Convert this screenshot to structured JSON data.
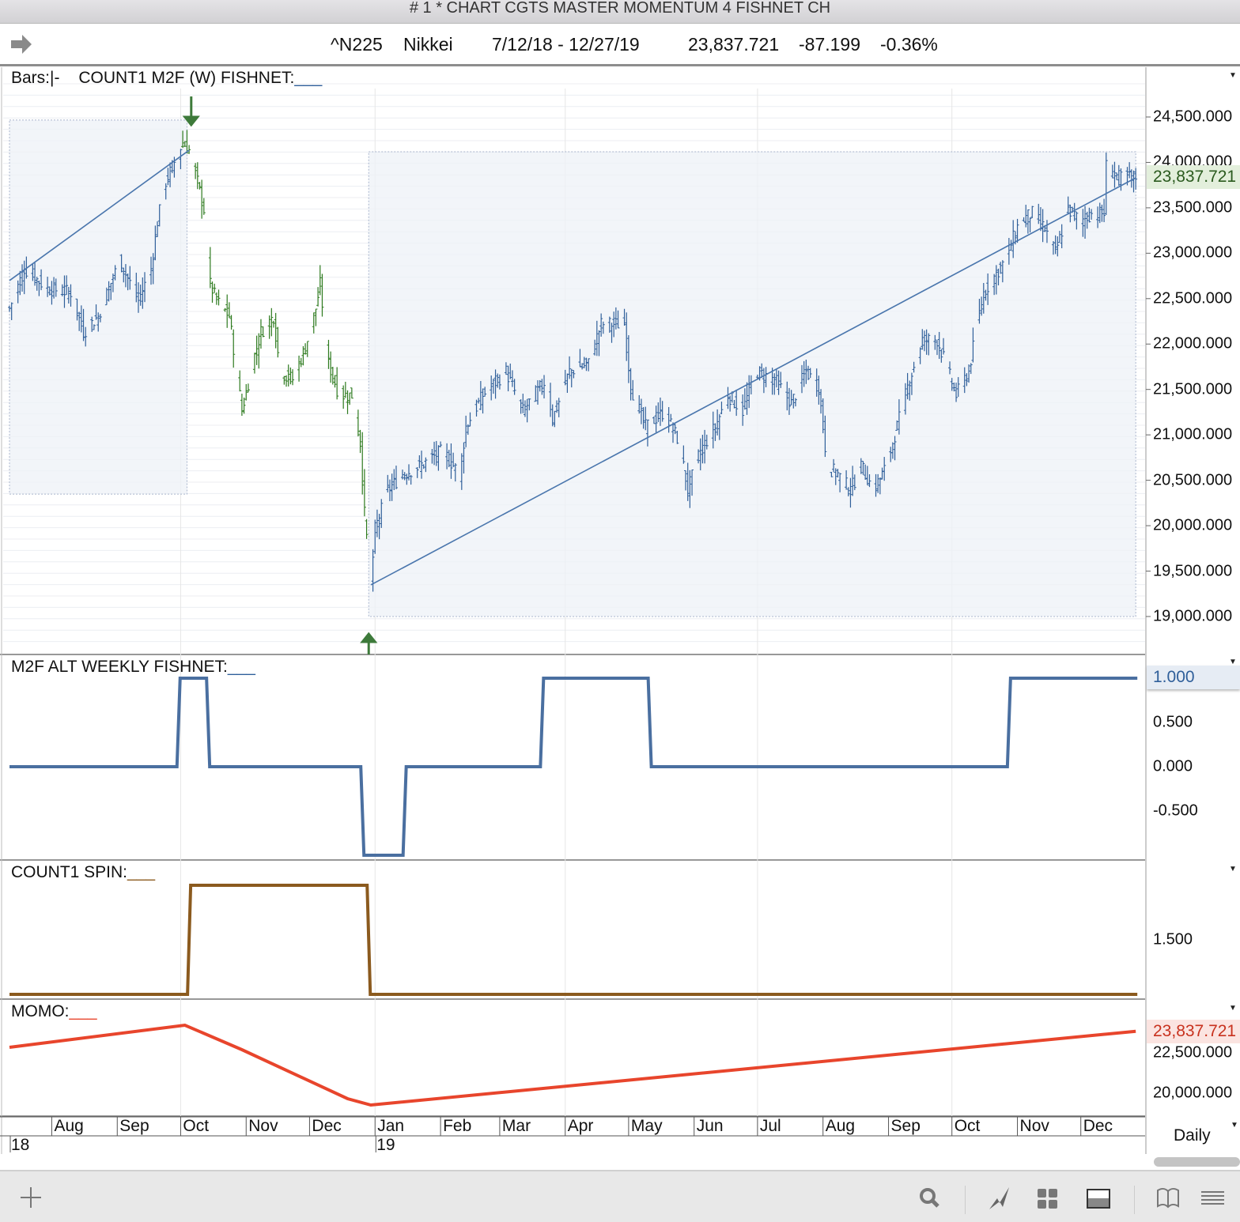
{
  "window_title": "# 1 * CHART CGTS MASTER MOMENTUM 4 FISHNET CH",
  "info": {
    "symbol": "^N225",
    "name": "Nikkei",
    "range": "7/12/18 - 12/27/19",
    "last": "23,837.721",
    "change": "-87.199",
    "pct": "-0.36%"
  },
  "panels": {
    "price_label": "Bars:",
    "price_bars_style": "|-",
    "price_study": "COUNT1 M2F (W) FISHNET:",
    "m2f_label": "M2F ALT WEEKLY FISHNET:",
    "spin_label": "COUNT1 SPIN:",
    "momo_label": "MOMO:",
    "blank": "___"
  },
  "interval": "Daily",
  "colors": {
    "up_bars": "#2f5f9a",
    "down_bars": "#2d7a1e",
    "m2f": "#4a6fa0",
    "spin": "#8b5a1e",
    "momo": "#e8452c",
    "box": "#eef1f7",
    "last_tag": "#e3efdc",
    "momo_tag": "#fbe4e1"
  },
  "chart_data": [
    {
      "type": "bar",
      "title": "^N225 Nikkei daily bars",
      "x_unit": "days since 2018-07-12",
      "ylim": [
        18700,
        24900
      ],
      "yticks": [
        "24,500.000",
        "24,000.000",
        "23,500.000",
        "23,000.000",
        "22,500.000",
        "22,000.000",
        "21,500.000",
        "21,000.000",
        "20,500.000",
        "20,000.000",
        "19,500.000",
        "19,000.000"
      ],
      "ytick_values": [
        24500,
        24000,
        23500,
        23000,
        22500,
        22000,
        21500,
        21000,
        20500,
        20000,
        19500,
        19000
      ],
      "last_value_label": "23,837.721",
      "down_segment_days": [
        82,
        171
      ],
      "closes": [
        [
          0,
          22394
        ],
        [
          7,
          22829
        ],
        [
          18,
          22611
        ],
        [
          29,
          22568
        ],
        [
          35,
          22133
        ],
        [
          42,
          22307
        ],
        [
          52,
          22916
        ],
        [
          61,
          22481
        ],
        [
          67,
          22829
        ],
        [
          70,
          23351
        ],
        [
          74,
          23786
        ],
        [
          82,
          24221
        ],
        [
          85,
          24134
        ],
        [
          89,
          23786
        ],
        [
          92,
          23482
        ],
        [
          95,
          22655
        ],
        [
          98,
          22481
        ],
        [
          104,
          22307
        ],
        [
          110,
          21262
        ],
        [
          115,
          21785
        ],
        [
          119,
          22133
        ],
        [
          125,
          22307
        ],
        [
          128,
          21698
        ],
        [
          134,
          21611
        ],
        [
          140,
          21959
        ],
        [
          145,
          22394
        ],
        [
          147,
          22655
        ],
        [
          151,
          21785
        ],
        [
          156,
          21437
        ],
        [
          162,
          21437
        ],
        [
          166,
          20914
        ],
        [
          168,
          20131
        ],
        [
          171,
          19348
        ],
        [
          173,
          19957
        ],
        [
          179,
          20392
        ],
        [
          186,
          20566
        ],
        [
          194,
          20653
        ],
        [
          205,
          20827
        ],
        [
          213,
          20566
        ],
        [
          216,
          21088
        ],
        [
          224,
          21437
        ],
        [
          235,
          21698
        ],
        [
          243,
          21262
        ],
        [
          254,
          21611
        ],
        [
          257,
          21175
        ],
        [
          265,
          21698
        ],
        [
          274,
          21785
        ],
        [
          280,
          22220
        ],
        [
          291,
          22220
        ],
        [
          294,
          21524
        ],
        [
          301,
          21088
        ],
        [
          310,
          21262
        ],
        [
          317,
          20914
        ],
        [
          321,
          20392
        ],
        [
          327,
          20827
        ],
        [
          334,
          21088
        ],
        [
          340,
          21437
        ],
        [
          347,
          21262
        ],
        [
          353,
          21698
        ],
        [
          362,
          21611
        ],
        [
          370,
          21349
        ],
        [
          377,
          21698
        ],
        [
          383,
          21524
        ],
        [
          387,
          20653
        ],
        [
          392,
          20566
        ],
        [
          398,
          20392
        ],
        [
          403,
          20653
        ],
        [
          409,
          20392
        ],
        [
          415,
          20653
        ],
        [
          420,
          21088
        ],
        [
          426,
          21611
        ],
        [
          432,
          22046
        ],
        [
          439,
          22046
        ],
        [
          443,
          21785
        ],
        [
          448,
          21437
        ],
        [
          454,
          21698
        ],
        [
          458,
          22220
        ],
        [
          461,
          22568
        ],
        [
          471,
          22916
        ],
        [
          478,
          23351
        ],
        [
          484,
          23438
        ],
        [
          490,
          23264
        ],
        [
          495,
          23003
        ],
        [
          501,
          23482
        ],
        [
          507,
          23351
        ],
        [
          512,
          23438
        ],
        [
          518,
          23438
        ],
        [
          519,
          23960
        ],
        [
          525,
          23830
        ],
        [
          533,
          23838
        ]
      ],
      "fishnet_boxes": [
        {
          "days": [
            0,
            84
          ],
          "range": [
            20348,
            24466
          ]
        },
        {
          "days": [
            170,
            533
          ],
          "range": [
            19000,
            24117
          ]
        }
      ],
      "trend_lines": [
        {
          "from": [
            0,
            22699
          ],
          "to": [
            85,
            24134
          ]
        },
        {
          "from": [
            171,
            19348
          ],
          "to": [
            533,
            23830
          ]
        }
      ],
      "signals": [
        {
          "type": "sell-arrow",
          "day": 86
        },
        {
          "type": "buy-arrow",
          "day": 170
        }
      ]
    },
    {
      "type": "line",
      "title": "M2F ALT WEEKLY FISHNET",
      "ylim": [
        -1,
        1
      ],
      "yticks": [
        "1.000",
        "0.500",
        "0.000",
        "-0.500"
      ],
      "ytick_values": [
        1,
        0.5,
        0,
        -0.5
      ],
      "last_value_label": "1.000",
      "steps": [
        [
          0,
          0
        ],
        [
          80,
          1
        ],
        [
          94,
          0
        ],
        [
          167,
          -1
        ],
        [
          187,
          0
        ],
        [
          252,
          1
        ],
        [
          303,
          0
        ],
        [
          473,
          1
        ],
        [
          533,
          1
        ]
      ]
    },
    {
      "type": "line",
      "title": "COUNT1 SPIN",
      "ylim": [
        1,
        2
      ],
      "yticks": [
        "1.500"
      ],
      "ytick_values": [
        1.5
      ],
      "steps": [
        [
          0,
          1
        ],
        [
          85,
          2
        ],
        [
          170,
          1
        ],
        [
          533,
          1
        ]
      ]
    },
    {
      "type": "line",
      "title": "MOMO",
      "yticks": [
        "22,500.000",
        "20,000.000"
      ],
      "ytick_values": [
        22500,
        20000
      ],
      "last_value_label": "23,837.721",
      "points": [
        [
          0,
          22843
        ],
        [
          83,
          24216
        ],
        [
          110,
          22696
        ],
        [
          160,
          19657
        ],
        [
          171,
          19265
        ],
        [
          533,
          23838
        ]
      ]
    }
  ],
  "xaxis": {
    "months": [
      [
        "Aug",
        20
      ],
      [
        "Sep",
        51
      ],
      [
        "Oct",
        81
      ],
      [
        "Nov",
        112
      ],
      [
        "Dec",
        142
      ],
      [
        "Jan",
        173
      ],
      [
        "Feb",
        204
      ],
      [
        "Mar",
        232
      ],
      [
        "Apr",
        263
      ],
      [
        "May",
        293
      ],
      [
        "Jun",
        324
      ],
      [
        "Jul",
        354
      ],
      [
        "Aug",
        385
      ],
      [
        "Sep",
        416
      ],
      [
        "Oct",
        446
      ],
      [
        "Nov",
        477
      ],
      [
        "Dec",
        507
      ]
    ],
    "years": [
      [
        "18",
        0
      ],
      [
        "19",
        173
      ]
    ]
  }
}
